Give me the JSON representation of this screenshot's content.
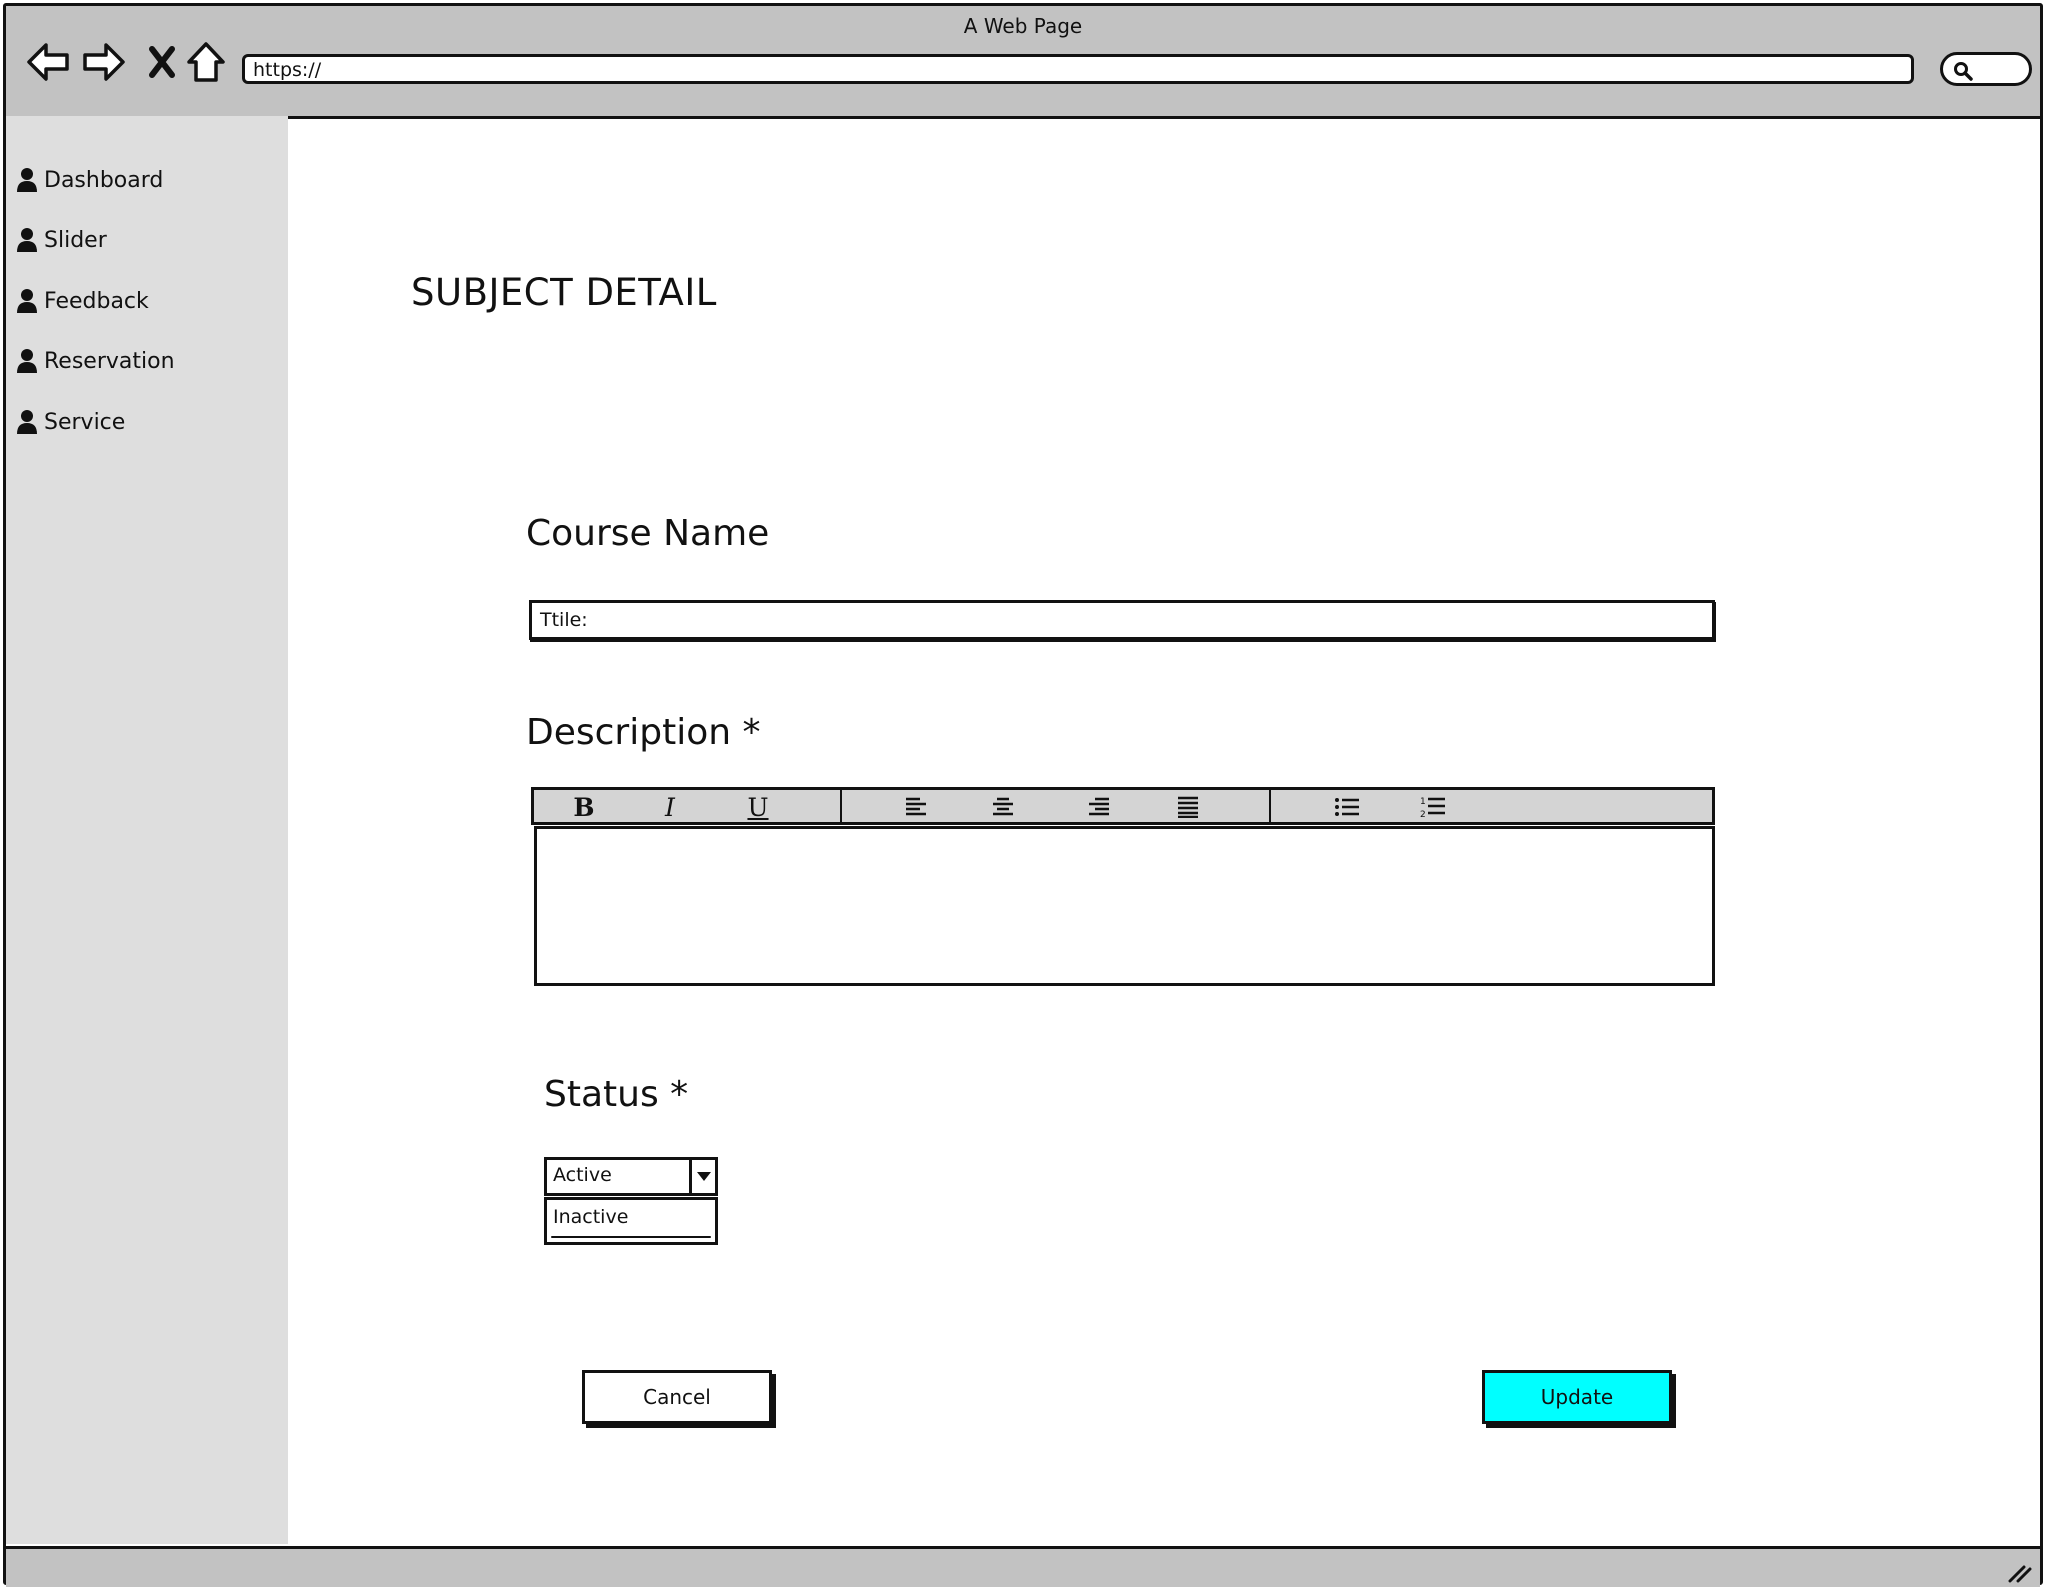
{
  "window": {
    "title": "A Web Page",
    "url": "https://"
  },
  "sidebar": {
    "items": [
      {
        "label": "Dashboard",
        "icon": "user-icon"
      },
      {
        "label": "Slider",
        "icon": "user-icon"
      },
      {
        "label": "Feedback",
        "icon": "user-icon"
      },
      {
        "label": "Reservation",
        "icon": "user-icon"
      },
      {
        "label": "Service",
        "icon": "user-icon"
      }
    ]
  },
  "main": {
    "page_title": "SUBJECT DETAIL",
    "course_name_label": "Course Name",
    "title_input_value": "Ttile:",
    "description_label": "Description *",
    "editor_toolbar": {
      "bold": "B",
      "italic": "I",
      "underline": "U"
    },
    "status_label": "Status *",
    "status_selected": "Active",
    "status_options": [
      "Inactive"
    ],
    "cancel_label": "Cancel",
    "update_label": "Update"
  },
  "colors": {
    "update_button": "#00ffff",
    "chrome": "#c2c2c2",
    "sidebar": "#dedede"
  }
}
